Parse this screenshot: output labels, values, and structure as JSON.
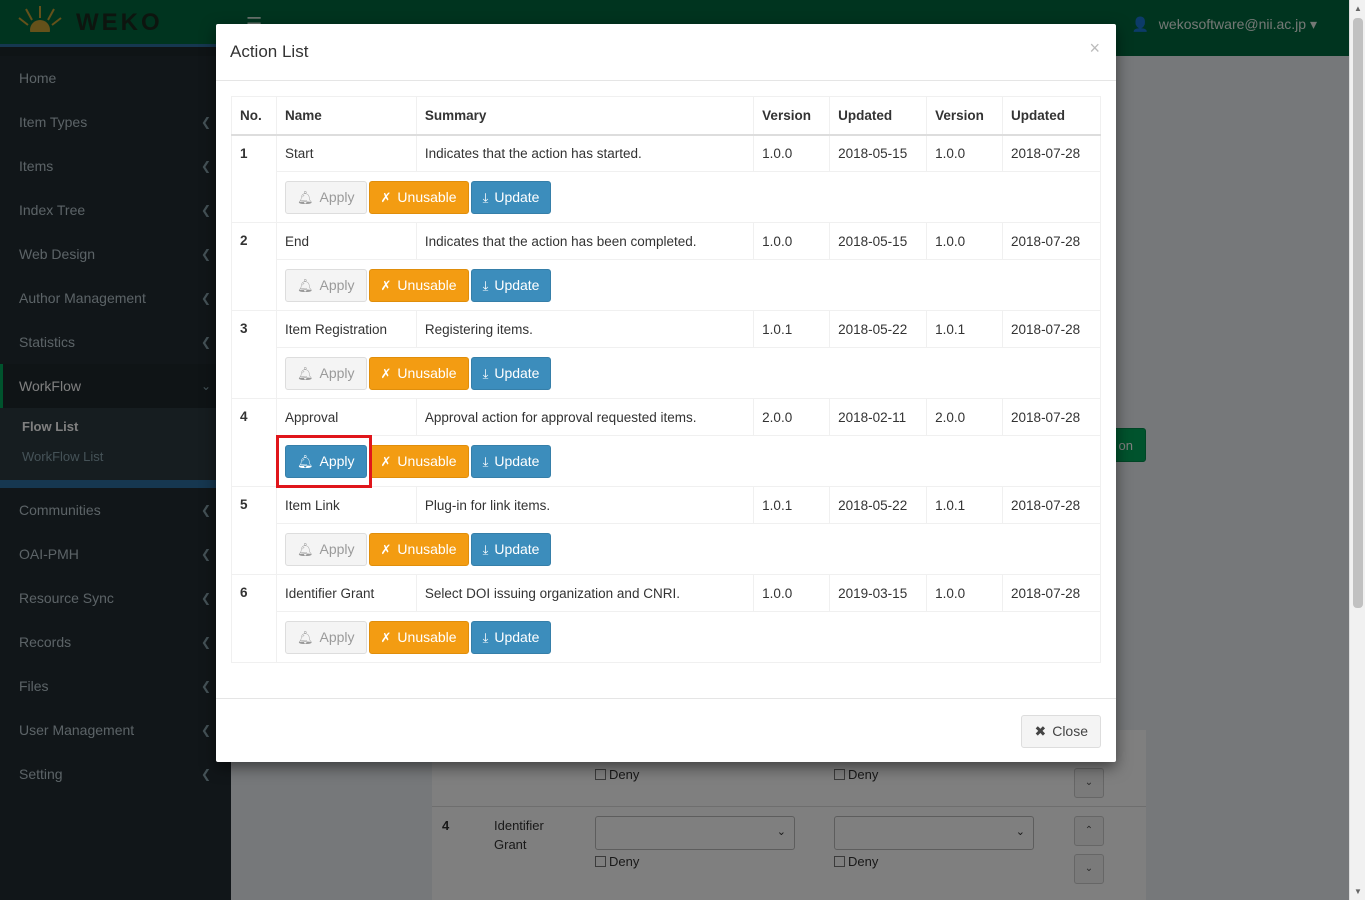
{
  "brand": {
    "logo_text": "WEKO"
  },
  "header": {
    "user": "wekosoftware@nii.ac.jp"
  },
  "sidebar": {
    "items": [
      {
        "label": "Home"
      },
      {
        "label": "Item Types"
      },
      {
        "label": "Items"
      },
      {
        "label": "Index Tree"
      },
      {
        "label": "Web Design"
      },
      {
        "label": "Author Management"
      },
      {
        "label": "Statistics"
      },
      {
        "label": "WorkFlow"
      },
      {
        "label": "Communities"
      },
      {
        "label": "OAI-PMH"
      },
      {
        "label": "Resource Sync"
      },
      {
        "label": "Records"
      },
      {
        "label": "Files"
      },
      {
        "label": "User Management"
      },
      {
        "label": "Setting"
      }
    ],
    "workflow_sub": [
      "Flow List",
      "WorkFlow List"
    ]
  },
  "background": {
    "row4_no": "4",
    "row4_name_1": "Identifier",
    "row4_name_2": "Grant",
    "deny": "Deny",
    "green_btn_text": "on"
  },
  "modal": {
    "title": "Action List",
    "close_x": "×",
    "columns": [
      "No.",
      "Name",
      "Summary",
      "Version",
      "Updated",
      "Version",
      "Updated"
    ],
    "buttons": {
      "apply": "Apply",
      "unusable": "Unusable",
      "update": "Update"
    },
    "rows": [
      {
        "no": "1",
        "name": "Start",
        "summary": "Indicates that the action has started.",
        "version": "1.0.0",
        "updated": "2018-05-15",
        "version2": "1.0.0",
        "updated2": "2018-07-28",
        "applied": false
      },
      {
        "no": "2",
        "name": "End",
        "summary": "Indicates that the action has been completed.",
        "version": "1.0.0",
        "updated": "2018-05-15",
        "version2": "1.0.0",
        "updated2": "2018-07-28",
        "applied": false
      },
      {
        "no": "3",
        "name": "Item Registration",
        "summary": "Registering items.",
        "version": "1.0.1",
        "updated": "2018-05-22",
        "version2": "1.0.1",
        "updated2": "2018-07-28",
        "applied": false
      },
      {
        "no": "4",
        "name": "Approval",
        "summary": "Approval action for approval requested items.",
        "version": "2.0.0",
        "updated": "2018-02-11",
        "version2": "2.0.0",
        "updated2": "2018-07-28",
        "applied": true
      },
      {
        "no": "5",
        "name": "Item Link",
        "summary": "Plug-in for link items.",
        "version": "1.0.1",
        "updated": "2018-05-22",
        "version2": "1.0.1",
        "updated2": "2018-07-28",
        "applied": false
      },
      {
        "no": "6",
        "name": "Identifier Grant",
        "summary": "Select DOI issuing organization and CNRI.",
        "version": "1.0.0",
        "updated": "2019-03-15",
        "version2": "1.0.0",
        "updated2": "2018-07-28",
        "applied": false
      }
    ],
    "close_label": "Close"
  },
  "colors": {
    "header": "#00693e",
    "sidebar": "#222d32",
    "primary": "#3c8dbc",
    "warning": "#f39c12",
    "highlight": "#e0161b"
  }
}
